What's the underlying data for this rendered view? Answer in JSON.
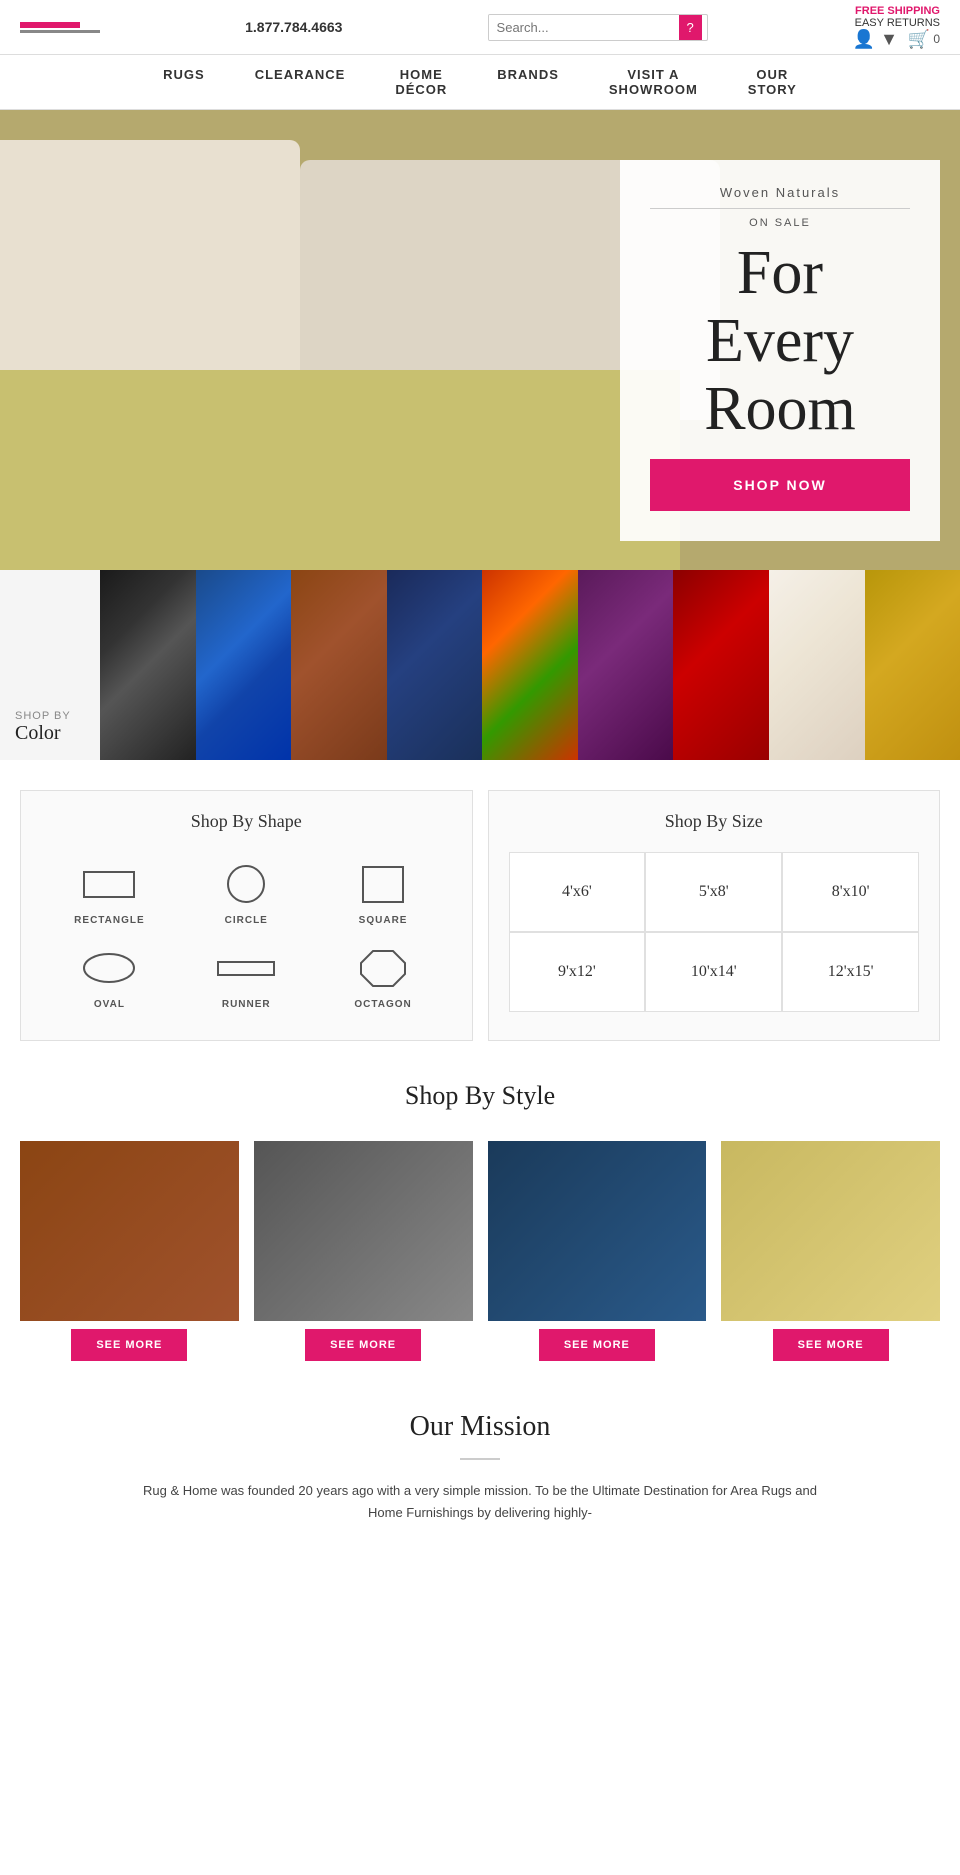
{
  "header": {
    "phone": "1.877.784.4663",
    "search_placeholder": "Search...",
    "free_shipping": "FREE SHIPPING",
    "easy_returns": "EASY RETURNS",
    "cart_count": "0"
  },
  "nav": {
    "items": [
      {
        "label": "RUGS"
      },
      {
        "label": "CLEARANCE"
      },
      {
        "label": "HOME\nDÉCOR"
      },
      {
        "label": "BRANDS"
      },
      {
        "label": "VISIT A\nSHOWROOM"
      },
      {
        "label": "OUR\nSTORY"
      }
    ]
  },
  "hero": {
    "subtitle": "Woven Naturals",
    "on_sale": "ON SALE",
    "title_line1": "For",
    "title_line2": "Every",
    "title_line3": "Room",
    "shop_btn": "SHOP NOW"
  },
  "color_strip": {
    "shop_by": "SHOP BY",
    "color_label": "Color",
    "swatches": [
      "black",
      "blue",
      "rust",
      "navy",
      "multicolor",
      "purple",
      "red",
      "cream",
      "gold"
    ]
  },
  "shape_section": {
    "title": "Shop By Shape",
    "shapes": [
      {
        "label": "RECTANGLE"
      },
      {
        "label": "CIRCLE"
      },
      {
        "label": "SQUARE"
      },
      {
        "label": "OVAL"
      },
      {
        "label": "RUNNER"
      },
      {
        "label": "OCTAGON"
      }
    ]
  },
  "size_section": {
    "title": "Shop By Size",
    "sizes": [
      "4'x6'",
      "5'x8'",
      "8'x10'",
      "9'x12'",
      "10'x14'",
      "12'x15'"
    ]
  },
  "style_section": {
    "title": "Shop By Style",
    "cards": [
      {
        "label": "SEE\nMORE"
      },
      {
        "label": "SEE\nMORE"
      },
      {
        "label": "SEE\nMORE"
      },
      {
        "label": "SEE\nMORE"
      }
    ]
  },
  "mission": {
    "title": "Our Mission",
    "text": "Rug & Home was founded 20 years ago with a very simple mission. To be the Ultimate Destination for Area Rugs and Home Furnishings by delivering highly-"
  }
}
